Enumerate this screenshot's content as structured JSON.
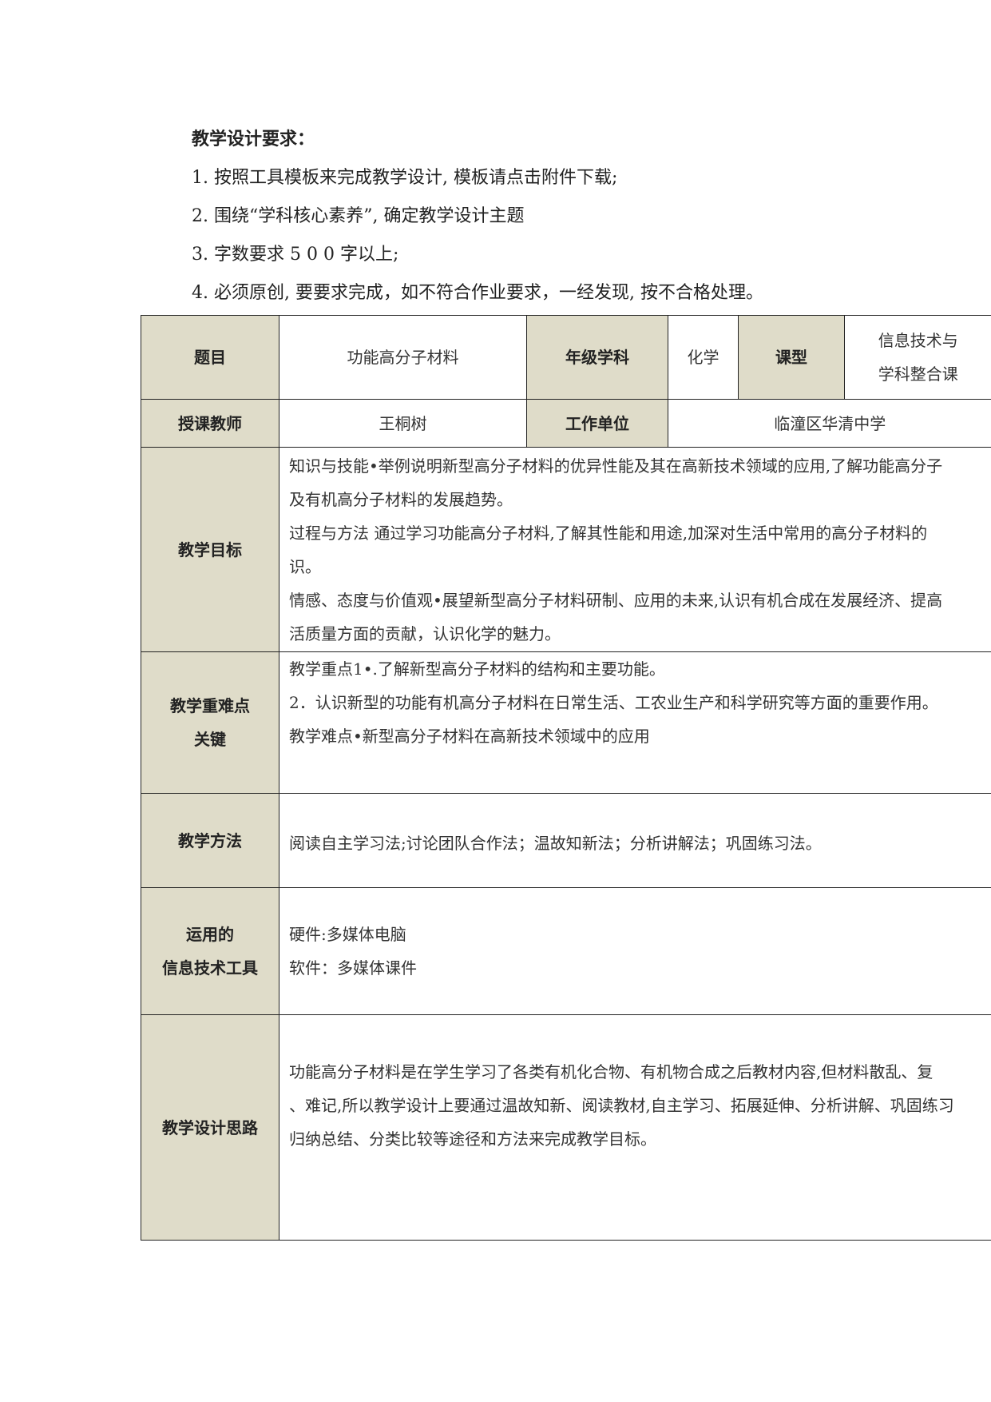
{
  "requirements": {
    "title": "教学设计要求：",
    "items": [
      "1. 按照工具模板来完成教学设计, 模板请点击附件下载;",
      "2.    围绕“学科核心素养”, 确定教学设计主题",
      "3. 字数要求 5 0 0 字以上;",
      "4. 必须原创, 要要求完成，如不符合作业要求，一经发现, 按不合格处理。"
    ]
  },
  "table": {
    "row1": {
      "topic_label": "题目",
      "topic_value": "功能高分子材料",
      "grade_label": "年级学科",
      "grade_value": "化学",
      "type_label": "课型",
      "type_value_line1": "信息技术与",
      "type_value_line2": "学科整合课"
    },
    "row2": {
      "teacher_label": "授课教师",
      "teacher_value": "王桐树",
      "unit_label": "工作单位",
      "unit_value": "临潼区华清中学"
    },
    "goals": {
      "label": "教学目标",
      "lines": [
        "知识与技能•举例说明新型高分子材料的优异性能及其在高新技术领域的应用,了解功能高分子",
        "及有机高分子材料的发展趋势。",
        "过程与方法    通过学习功能高分子材料,了解其性能和用途,加深对生活中常用的高分子材料的",
        "识。",
        "情感、态度与价值观•展望新型高分子材料研制、应用的未来,认识有机合成在发展经济、提高",
        "活质量方面的贡献，认识化学的魅力。"
      ]
    },
    "key_points": {
      "label_line1": "教学重难点",
      "label_line2": "关键",
      "lines": [
        "教学重点1•.了解新型高分子材料的结构和主要功能。",
        "2．认识新型的功能有机高分子材料在日常生活、工农业生产和科学研究等方面的重要作用。",
        "教学难点•新型高分子材料在高新技术领域中的应用"
      ]
    },
    "methods": {
      "label": "教学方法",
      "text": "阅读自主学习法;讨论团队合作法；温故知新法；分析讲解法；巩固练习法。"
    },
    "tools": {
      "label_line1": "运用的",
      "label_line2": "信息技术工具",
      "lines": [
        "硬件:多媒体电脑",
        "软件：多媒体课件"
      ]
    },
    "design": {
      "label": "教学设计思路",
      "lines": [
        "功能高分子材料是在学生学习了各类有机化合物、有机物合成之后教材内容,但材料散乱、复",
        "、难记,所以教学设计上要通过温故知新、阅读教材,自主学习、拓展延伸、分析讲解、巩固练习",
        "归纳总结、分类比较等途径和方法来完成教学目标。"
      ]
    }
  }
}
